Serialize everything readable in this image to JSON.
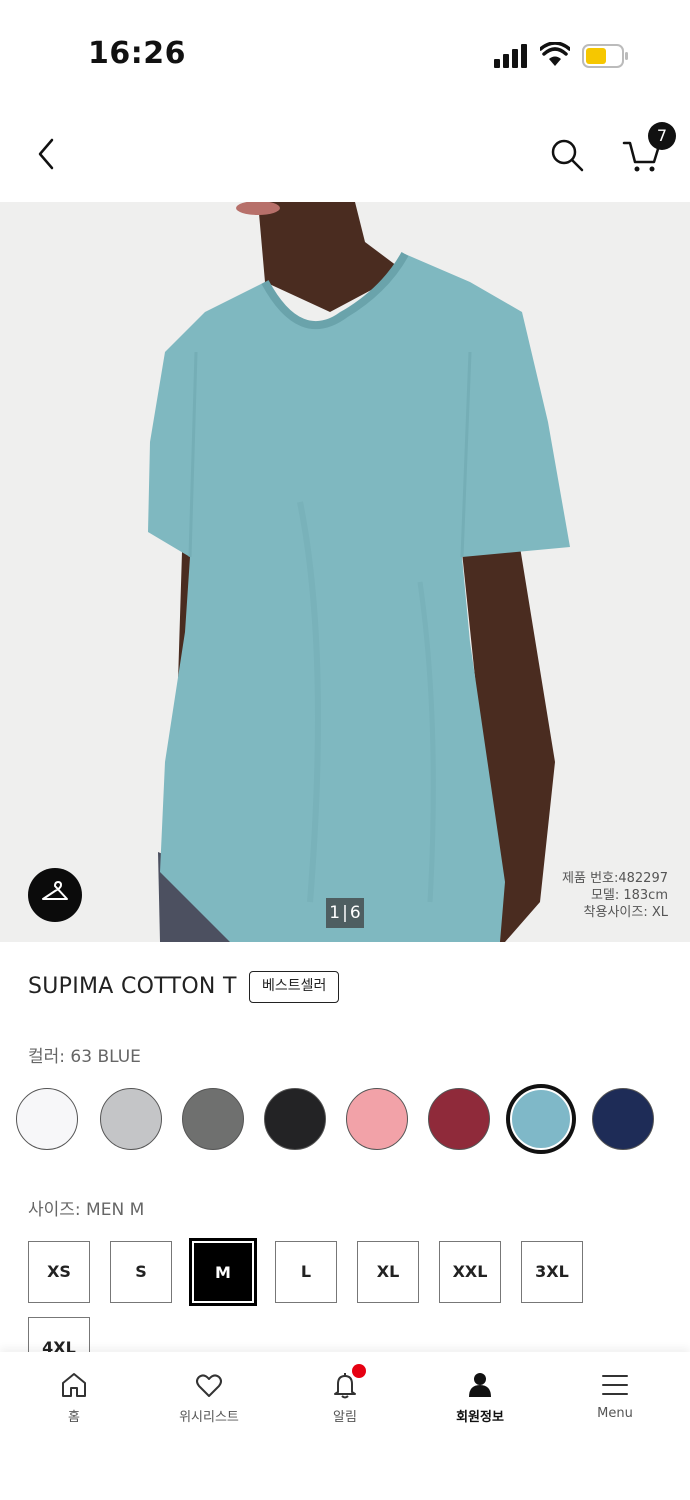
{
  "status_bar": {
    "time": "16:26",
    "battery_color": "#f6c700"
  },
  "header": {
    "back_icon": "chevron-left-icon",
    "search_icon": "search-icon",
    "cart_icon": "cart-icon",
    "cart_count": "7"
  },
  "gallery": {
    "page_current": "1",
    "page_total": "6",
    "info_product_no": "제품 번호:482297",
    "info_model": "모델: 183cm",
    "info_size": "착용사이즈: XL",
    "shirt_color": "#7fb8c0"
  },
  "product": {
    "title": "SUPIMA COTTON T",
    "badge": "베스트셀러",
    "color_label": "컬러: 63 BLUE",
    "colors": [
      {
        "name": "white",
        "hex": "#f7f7f9"
      },
      {
        "name": "light-gray",
        "hex": "#c4c5c7"
      },
      {
        "name": "gray",
        "hex": "#6f706f"
      },
      {
        "name": "black",
        "hex": "#232325"
      },
      {
        "name": "pink",
        "hex": "#f2a2a8"
      },
      {
        "name": "wine",
        "hex": "#8f2a3a"
      },
      {
        "name": "blue",
        "hex": "#7fb8c8",
        "selected": true
      },
      {
        "name": "navy",
        "hex": "#1e2c57"
      }
    ],
    "size_label": "사이즈: MEN M",
    "sizes": [
      "XS",
      "S",
      "M",
      "L",
      "XL",
      "XXL",
      "3XL",
      "4XL"
    ],
    "selected_size": "M"
  },
  "bottom_nav": {
    "items": [
      {
        "label": "홈",
        "icon": "home-icon"
      },
      {
        "label": "위시리스트",
        "icon": "heart-icon"
      },
      {
        "label": "알림",
        "icon": "bell-icon"
      },
      {
        "label": "회원정보",
        "icon": "person-icon",
        "active": true
      },
      {
        "label": "Menu",
        "icon": "menu-icon"
      }
    ]
  }
}
